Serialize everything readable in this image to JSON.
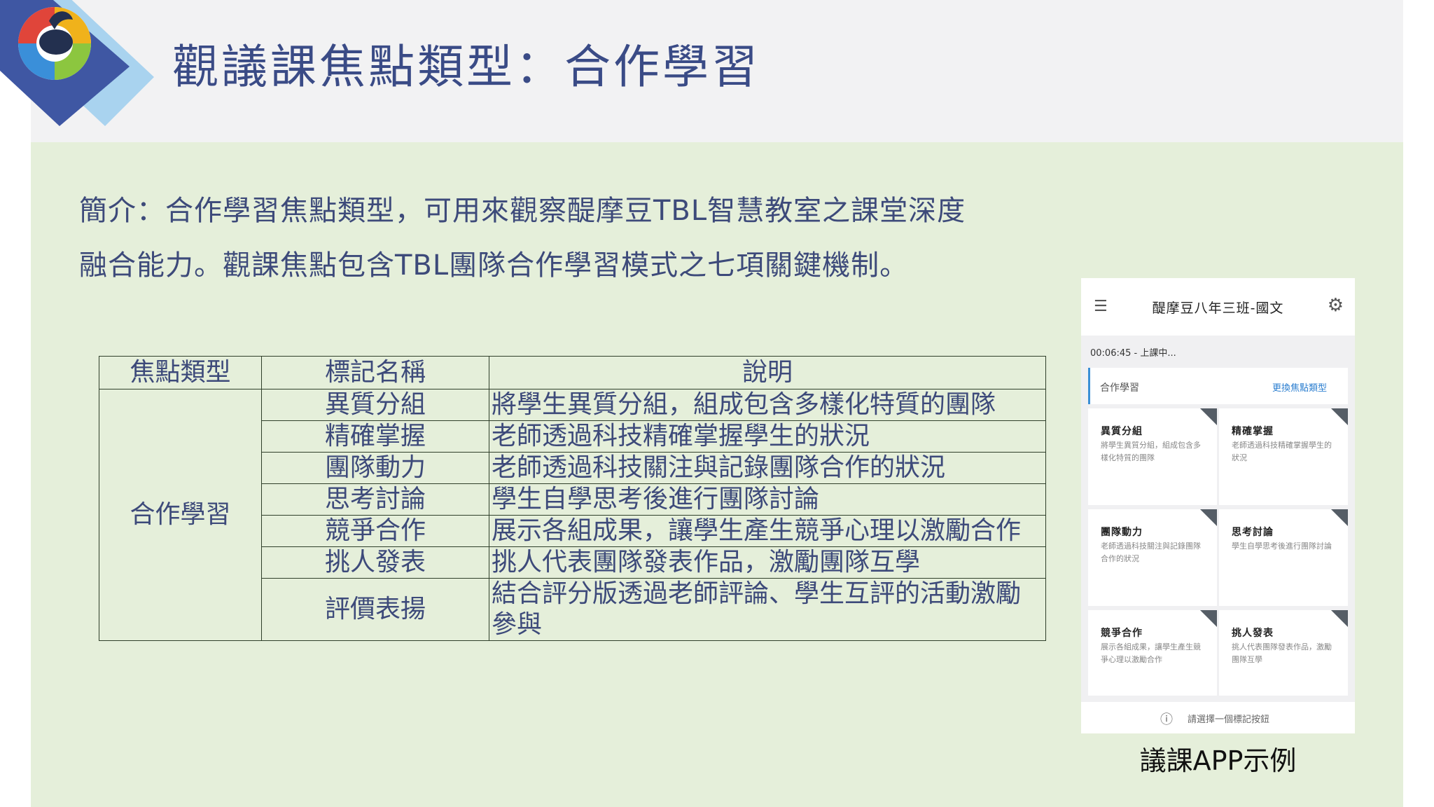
{
  "header": {
    "title": "觀議課焦點類型：合作學習"
  },
  "intro": {
    "line1": "簡介：合作學習焦點類型，可用來觀察醍摩豆TBL智慧教室之課堂深度",
    "line2": "融合能力。觀課焦點包含TBL團隊合作學習模式之七項關鍵機制。"
  },
  "table": {
    "headers": [
      "焦點類型",
      "標記名稱",
      "說明"
    ],
    "category": "合作學習",
    "rows": [
      {
        "name": "異質分組",
        "desc": "將學生異質分組，組成包含多樣化特質的團隊"
      },
      {
        "name": "精確掌握",
        "desc": "老師透過科技精確掌握學生的狀況"
      },
      {
        "name": "團隊動力",
        "desc": "老師透過科技關注與記錄團隊合作的狀況"
      },
      {
        "name": "思考討論",
        "desc": "學生自學思考後進行團隊討論"
      },
      {
        "name": "競爭合作",
        "desc": "展示各組成果，讓學生產生競爭心理以激勵合作"
      },
      {
        "name": "挑人發表",
        "desc": "挑人代表團隊發表作品，激勵團隊互學"
      },
      {
        "name": "評價表揚",
        "desc": "結合評分版透過老師評論、學生互評的活動激勵參與"
      }
    ]
  },
  "app": {
    "menu_icon": "menu-icon",
    "title": "醍摩豆八年三班-國文",
    "settings_icon": "gear-icon",
    "status": "00:06:45 - 上課中...",
    "focus_label": "合作學習",
    "change_link": "更換焦點類型",
    "cards": [
      {
        "title": "異質分組",
        "desc": "將學生異質分組，組成包含多樣化特質的團隊"
      },
      {
        "title": "精確掌握",
        "desc": "老師透過科技精確掌握學生的狀況"
      },
      {
        "title": "團隊動力",
        "desc": "老師透過科技關注與記錄團隊合作的狀況"
      },
      {
        "title": "思考討論",
        "desc": "學生自學思考後進行團隊討論"
      },
      {
        "title": "競爭合作",
        "desc": "展示各組成果，讓學生產生競爭心理以激勵合作"
      },
      {
        "title": "挑人發表",
        "desc": "挑人代表團隊發表作品，激勵團隊互學"
      }
    ],
    "footer_hint": "請選擇一個標記按鈕"
  },
  "caption": "議課APP示例",
  "colors": {
    "title": "#3a4b86",
    "content_bg": "#e5efda",
    "header_bg": "#f2f2f3",
    "link": "#2d7fd0"
  }
}
